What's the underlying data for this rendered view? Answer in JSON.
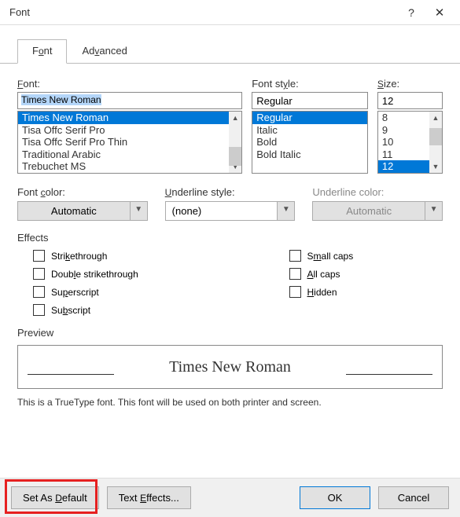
{
  "title": "Font",
  "tabs": {
    "font": "Font",
    "advanced": "Advanced"
  },
  "labels": {
    "font": "Font:",
    "fontstyle": "Font style:",
    "size": "Size:",
    "fontcolor": "Font color:",
    "underlinestyle": "Underline style:",
    "underlinecolor": "Underline color:",
    "effects": "Effects",
    "preview": "Preview"
  },
  "values": {
    "font": "Times New Roman",
    "fontstyle": "Regular",
    "size": "12",
    "fontcolor": "Automatic",
    "underlinestyle": "(none)",
    "underlinecolor": "Automatic"
  },
  "fontList": [
    "Times New Roman",
    "Tisa Offc Serif Pro",
    "Tisa Offc Serif Pro Thin",
    "Traditional Arabic",
    "Trebuchet MS"
  ],
  "styleList": [
    "Regular",
    "Italic",
    "Bold",
    "Bold Italic"
  ],
  "sizeList": [
    "8",
    "9",
    "10",
    "11",
    "12"
  ],
  "effects": {
    "strikethrough": "Strikethrough",
    "doublestrike": "Double strikethrough",
    "superscript": "Superscript",
    "subscript": "Subscript",
    "smallcaps": "Small caps",
    "allcaps": "All caps",
    "hidden": "Hidden"
  },
  "previewText": "Times New Roman",
  "description": "This is a TrueType font. This font will be used on both printer and screen.",
  "buttons": {
    "setdefault": "Set As Default",
    "texteffects": "Text Effects...",
    "ok": "OK",
    "cancel": "Cancel"
  }
}
